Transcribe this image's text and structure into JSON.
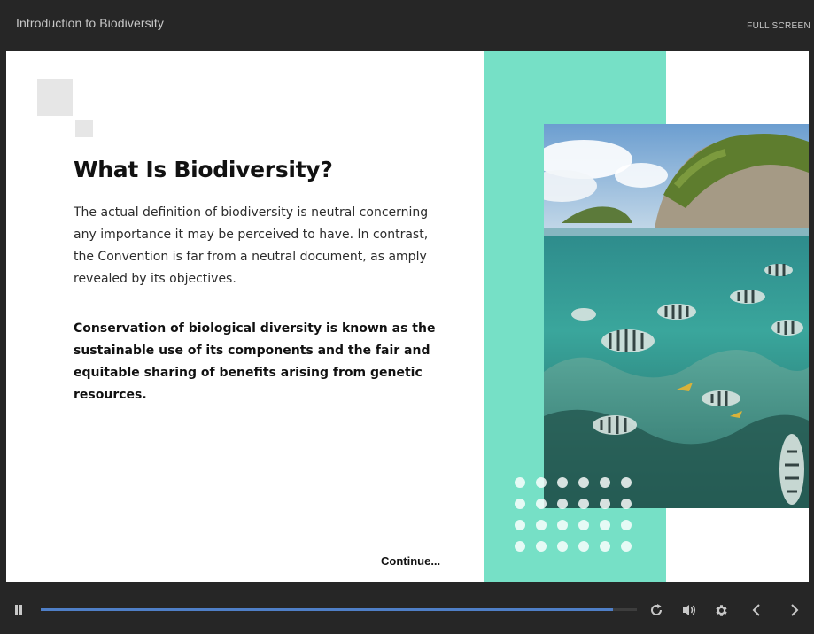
{
  "header": {
    "course_title": "Introduction to Biodiversity",
    "fullscreen_label": "FULL SCREEN"
  },
  "slide": {
    "heading": "What Is Biodiversity?",
    "paragraph": "The actual definition of biodiversity is neutral concerning any importance it may be perceived to have. In contrast, the Convention is far from a neutral document, as amply revealed by its objectives.",
    "bold_paragraph": "Conservation of biological diversity is known as the sustainable use of its components and the fair and equitable sharing of benefits arising from genetic resources.",
    "continue_label": "Continue...",
    "accent_color": "#76e0c6",
    "image_icon": "coral-reef-photo"
  },
  "player": {
    "progress": 0.96,
    "progress_color": "#4f7fc7",
    "icons": [
      "pause-icon",
      "replay-icon",
      "volume-icon",
      "gear-icon",
      "chevron-left-icon",
      "chevron-right-icon"
    ]
  }
}
